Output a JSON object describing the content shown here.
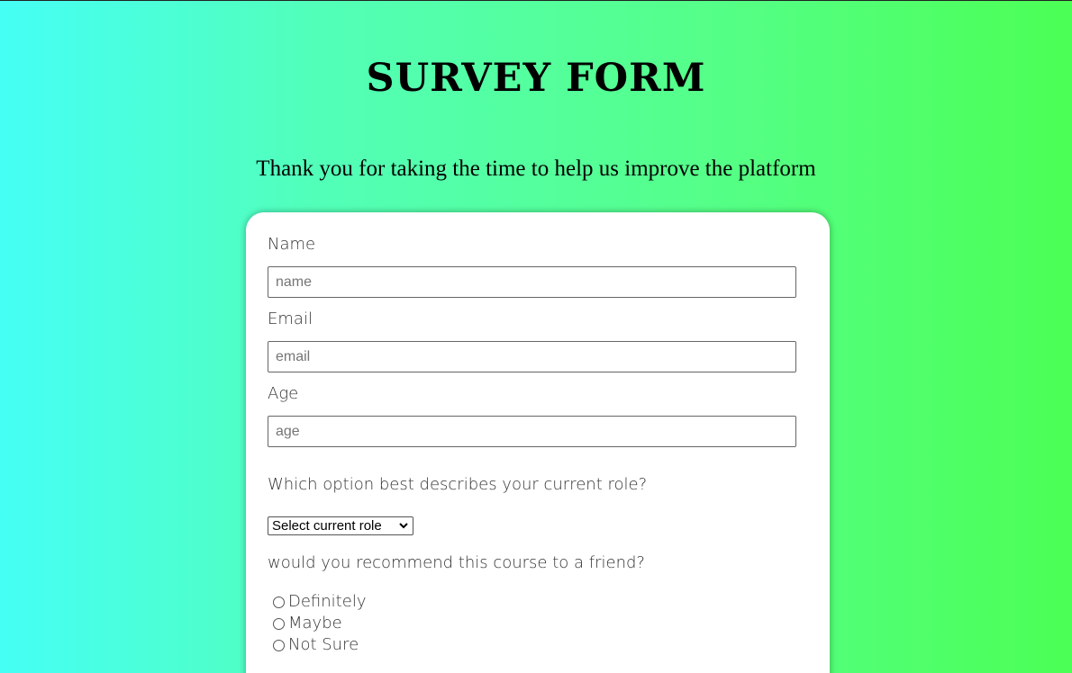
{
  "header": {
    "title": "SURVEY FORM",
    "subtitle": "Thank you for taking the time to help us improve the platform"
  },
  "form": {
    "name": {
      "label": "Name",
      "placeholder": "name",
      "value": ""
    },
    "email": {
      "label": "Email",
      "placeholder": "email",
      "value": ""
    },
    "age": {
      "label": "Age",
      "placeholder": "age",
      "value": ""
    },
    "role_question": "Which option best describes your current role?",
    "role_select": {
      "selected": "Select current role"
    },
    "recommend_question": "would you recommend this course to a friend?",
    "recommend_options": [
      {
        "label": "Definitely",
        "checked": false
      },
      {
        "label": "Maybe",
        "checked": false
      },
      {
        "label": "Not Sure",
        "checked": false
      }
    ]
  },
  "icons": {
    "select_chevron": "chevron-down-icon"
  },
  "colors": {
    "gradient_left": "#45fff5",
    "gradient_right": "#4cff55",
    "card_background": "#ffffff"
  }
}
